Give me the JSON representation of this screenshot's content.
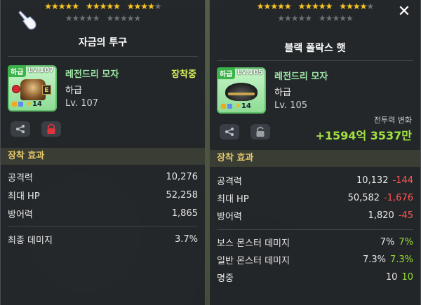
{
  "colors": {
    "accent_gold": "#e7c96b",
    "name_green": "#9ee5a6",
    "equipped_yellow": "#d8f05a",
    "delta_negative": "#ff5454",
    "delta_positive": "#9ade32"
  },
  "left": {
    "stars_row1": [
      5,
      5,
      4
    ],
    "stars_row1_total": [
      5,
      5,
      5
    ],
    "stars_row2_total": [
      5,
      5
    ],
    "title": "자금의 투구",
    "item": {
      "grade_tag": "하급",
      "level_tag": "Lv.107",
      "name": "레전드리 모자",
      "grade": "하급",
      "level": "Lv. 107",
      "star_count": "14",
      "icon": "helmet-icon"
    },
    "equip_status": "장착중",
    "section_title": "장착 효과",
    "stats": [
      {
        "label": "공격력",
        "value": "10,276"
      },
      {
        "label": "최대 HP",
        "value": "52,258"
      },
      {
        "label": "방어력",
        "value": "1,865"
      }
    ],
    "extra_stats": [
      {
        "label": "최종 데미지",
        "value": "3.7%"
      }
    ]
  },
  "right": {
    "title": "블랙 폴락스 햇",
    "item": {
      "grade_tag": "하급",
      "level_tag": "Lv.105",
      "name": "레전드리 모자",
      "grade": "하급",
      "level": "Lv. 105",
      "star_count": "14",
      "icon": "hat-icon"
    },
    "power_label": "전투력 변화",
    "power_value": "+1594억 3537만",
    "section_title": "장착 효과",
    "stats": [
      {
        "label": "공격력",
        "value": "10,132",
        "delta": "-144"
      },
      {
        "label": "최대 HP",
        "value": "50,582",
        "delta": "-1,676"
      },
      {
        "label": "방어력",
        "value": "1,820",
        "delta": "-45"
      }
    ],
    "extra_stats": [
      {
        "label": "보스 몬스터 데미지",
        "value": "7%",
        "delta": "7%"
      },
      {
        "label": "일반 몬스터 데미지",
        "value": "7.3%",
        "delta": "7.3%"
      },
      {
        "label": "명중",
        "value": "10",
        "delta": "10"
      }
    ]
  }
}
